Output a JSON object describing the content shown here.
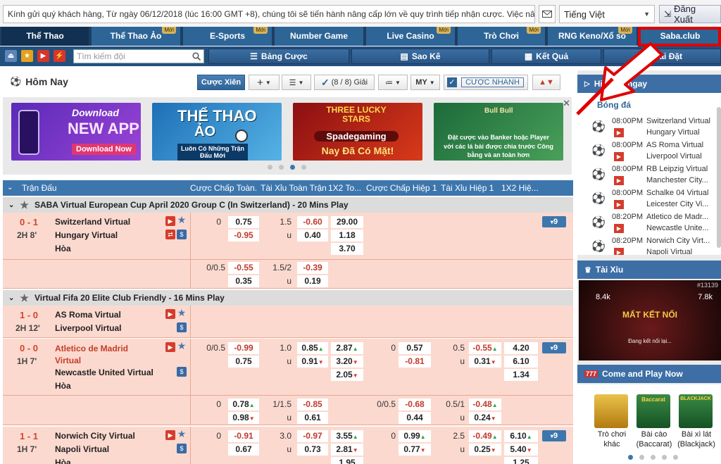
{
  "topbar": {
    "ticker": "Kính gửi quý khách hàng, Từ ngày 06/12/2018 (lúc 16:00 GMT +8), chúng tôi sẽ tiến hành nâng cấp lớn về quy trình tiếp nhận cược. Việc nâng cấp",
    "language": "Tiếng Việt",
    "logout": "Đăng Xuất"
  },
  "tabs": [
    {
      "label": "Thể Thao",
      "new": ""
    },
    {
      "label": "Thể Thao Ảo",
      "new": "Mới"
    },
    {
      "label": "E-Sports",
      "new": "Mới"
    },
    {
      "label": "Number Game",
      "new": ""
    },
    {
      "label": "Live Casino",
      "new": "Mới"
    },
    {
      "label": "Trò Chơi",
      "new": "Mới"
    },
    {
      "label": "RNG Keno/Xổ số",
      "new": "Mới"
    },
    {
      "label": "Saba.club",
      "new": ""
    }
  ],
  "toolbar": {
    "search_placeholder": "Tìm kiếm đội",
    "bet_table": "Bảng Cược",
    "statement": "Sao Kê",
    "results": "Kết Quả",
    "settings": "Cài Đặt"
  },
  "options": {
    "title": "Hôm Nay",
    "parlay": "Cược Xiên",
    "leagues": "(8 / 8) Giải",
    "odds_type": "MY",
    "quick_bet": "CƯỢC NHANH"
  },
  "banners": [
    {
      "line1": "Download",
      "line2": "NEW APP",
      "line3": "Download Now"
    },
    {
      "line1": "THỂ THAO",
      "line2": "ẢO",
      "line3": "Luôn Có Những Trận Đấu Mới"
    },
    {
      "line1": "THREE LUCKY STARS",
      "line2": "Spadegaming",
      "line3": "Nay Đã Có Mặt!"
    },
    {
      "line1": "Bull Bull",
      "line2": "Đặt cược vào Banker hoặc Player",
      "line3": "với các lá bài được chia trước Công bằng và an toàn hơn"
    }
  ],
  "table": {
    "headers": [
      "Trận Đấu",
      "Cược Chấp Toàn...",
      "Tài Xỉu Toàn Trận",
      "1X2 To...",
      "Cược Chấp Hiệp 1",
      "Tài Xỉu Hiệp 1",
      "1X2 Hiệ..."
    ],
    "league1": "SABA Virtual European Cup April 2020 Group C (In Switzerland) - 20 Mins Play",
    "league2": "Virtual Fifa 20 Elite Club Friendly - 16 Mins Play",
    "draw": "Hòa",
    "m1": {
      "score": "0 - 1",
      "time": "2H 8'",
      "home": "Switzerland Virtual",
      "away": "Hungary Virtual",
      "r1": {
        "hdp": "0",
        "h1": "0.75",
        "h2": "-0.95",
        "ou": "1.5",
        "o1": "-0.60",
        "o2": "0.40",
        "x1": "29.00",
        "x2": "1.18",
        "x3": "3.70"
      },
      "r2": {
        "hdp": "0/0.5",
        "h1": "-0.55",
        "h2": "0.35",
        "ou": "1.5/2",
        "o1": "-0.39",
        "o2": "0.19"
      },
      "more": "9"
    },
    "m2": {
      "score": "1 - 0",
      "time": "2H 12'",
      "home": "AS Roma Virtual",
      "away": "Liverpool Virtual"
    },
    "m3": {
      "score": "0 - 0",
      "time": "1H 7'",
      "home": "Atletico de Madrid Virtual",
      "away": "Newcastle United Virtual",
      "r1": {
        "hdp": "0/0.5",
        "h1": "-0.99",
        "h2": "0.75",
        "ou": "1.0",
        "o1": "0.85",
        "o2": "0.91",
        "x1": "2.87",
        "x2": "3.20",
        "x3": "2.05",
        "fh": "0",
        "f1": "0.57",
        "f2": "-0.81",
        "fou": "0.5",
        "fo1": "-0.55",
        "fo2": "0.31",
        "fx1": "4.20",
        "fx2": "6.10",
        "fx3": "1.34"
      },
      "r2": {
        "hdp": "0",
        "h1": "0.78",
        "h2": "0.98",
        "ou": "1/1.5",
        "o1": "-0.85",
        "o2": "0.61",
        "fh": "0/0.5",
        "f1": "-0.68",
        "f2": "0.44",
        "fou": "0.5/1",
        "fo1": "-0.48",
        "fo2": "0.24"
      },
      "more": "9"
    },
    "m4": {
      "score": "1 - 1",
      "time": "1H 7'",
      "home": "Norwich City Virtual",
      "away": "Napoli Virtual",
      "r1": {
        "hdp": "0",
        "h1": "-0.91",
        "h2": "0.67",
        "ou": "3.0",
        "o1": "-0.97",
        "o2": "0.73",
        "x1": "3.55",
        "x2": "2.81",
        "x3": "1.95",
        "fh": "0",
        "f1": "0.99",
        "f2": "0.77",
        "fou": "2.5",
        "fo1": "-0.49",
        "fo2": "0.25",
        "fx1": "6.10",
        "fx2": "5.40",
        "fx3": "1.25"
      },
      "more": "9"
    },
    "u": "u"
  },
  "rightpanel": {
    "live_title": "Hiển thị ngay",
    "sport": "Bóng đá",
    "live": [
      {
        "time": "08:00PM",
        "home": "Switzerland Virtual",
        "away": "Hungary Virtual"
      },
      {
        "time": "08:00PM",
        "home": "AS Roma Virtual",
        "away": "Liverpool Virtual"
      },
      {
        "time": "08:00PM",
        "home": "RB Leipzig Virtual",
        "away": "Manchester City..."
      },
      {
        "time": "08:00PM",
        "home": "Schalke 04 Virtual",
        "away": "Leicester City Vi..."
      },
      {
        "time": "08:20PM",
        "home": "Atletico de Madr...",
        "away": "Newcastle Unite..."
      },
      {
        "time": "08:20PM",
        "home": "Norwich City Virt...",
        "away": "Napoli Virtual"
      }
    ],
    "taixiu_title": "Tài Xỉu",
    "lost_connection": "MẤT KẾT NỐI",
    "reconnecting": "Đang kết nối lại...",
    "game_num": "#13139",
    "v1": "8.4k",
    "v2": "7.8k",
    "come_play": "Come and Play Now",
    "games": [
      {
        "label": "Trò chơi khác"
      },
      {
        "label": "Bài cào (Baccarat)",
        "tile": "Baccarat"
      },
      {
        "label": "Bài xì lát (Blackjack)",
        "tile": "BLACKJACK"
      }
    ]
  },
  "colors": {
    "nav": "#2e6597",
    "active_tab": "#123152",
    "row": "#fcd9cf",
    "accent_red": "#e00000"
  }
}
